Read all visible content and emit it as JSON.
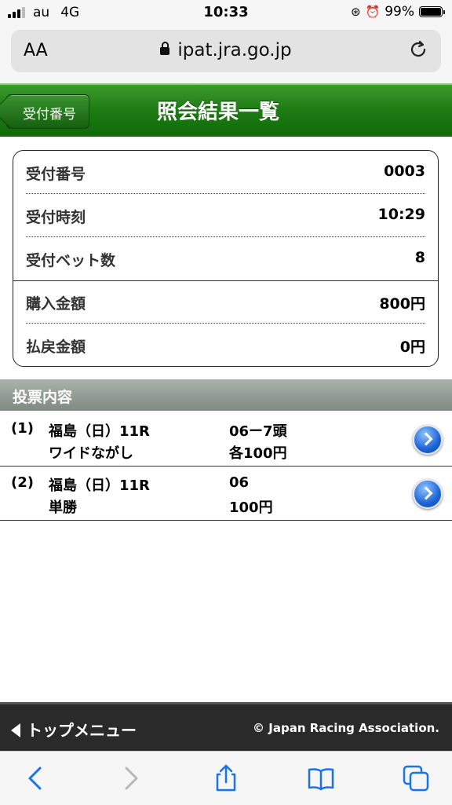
{
  "status_bar": {
    "carrier": "au",
    "network": "4G",
    "time": "10:33",
    "battery": "99%"
  },
  "browser": {
    "text_size_label": "AA",
    "url": "ipat.jra.go.jp"
  },
  "header": {
    "back_label": "受付番号",
    "title": "照会結果一覧"
  },
  "info": {
    "rows": [
      {
        "label": "受付番号",
        "value": "0003"
      },
      {
        "label": "受付時刻",
        "value": "10:29"
      },
      {
        "label": "受付ベット数",
        "value": "8"
      },
      {
        "label": "購入金額",
        "value": "800円"
      },
      {
        "label": "払戻金額",
        "value": "0円"
      }
    ]
  },
  "section_title": "投票内容",
  "bets": [
    {
      "num": "(1)",
      "race": "福島（日）11R",
      "type": "ワイドながし",
      "selection": "06ー7頭",
      "amount": "各100円"
    },
    {
      "num": "(2)",
      "race": "福島（日）11R",
      "type": "単勝",
      "selection": "06",
      "amount": "100円"
    }
  ],
  "footer": {
    "top_menu": "トップメニュー",
    "copyright": "© Japan Racing Association."
  },
  "toolbar_icons": [
    "back-icon",
    "forward-icon",
    "share-icon",
    "bookmarks-icon",
    "tabs-icon"
  ]
}
